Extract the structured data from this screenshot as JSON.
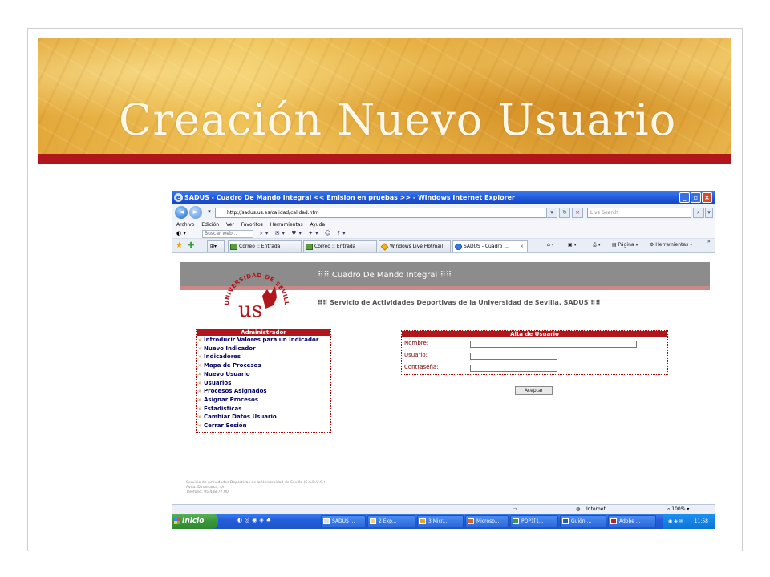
{
  "slide": {
    "title": "Creación Nuevo Usuario"
  },
  "browser": {
    "window_title": "SADUS - Cuadro De Mando Integral << Emision en pruebas >> - Windows Internet Explorer",
    "address": "http://sadus.us.es/calidad/calidad.htm",
    "search_placeholder": "Live Search",
    "search_web_placeholder": "Buscar web...",
    "menu": [
      "Archivo",
      "Edición",
      "Ver",
      "Favoritos",
      "Herramientas",
      "Ayuda"
    ],
    "tabs": [
      {
        "label": "Correo :: Entrada",
        "active": false
      },
      {
        "label": "Correo :: Entrada",
        "active": false
      },
      {
        "label": "Windows Live Hotmail",
        "active": false
      },
      {
        "label": "SADUS - Cuadro ...",
        "active": true
      }
    ],
    "commands": {
      "page": "Página",
      "tools": "Herramientas"
    },
    "status": {
      "zone": "Internet",
      "zoom": "100%"
    }
  },
  "site": {
    "title": "Cuadro De Mando Integral",
    "subtitle": "Servicio de Actividades Deportivas de la Universidad de Sevilla. SADUS",
    "logo_ring_text": "UNIVERSIDAD DE SEVILLA",
    "logo_letters": "us",
    "title_marks": "⠿⠿",
    "footer": [
      "Servicio de Actividades Deportivas de la Universidad de Sevilla (S.A.D.U.S.)",
      "Avda. Dinamarca, s/n",
      "Teléfono: 95.448.77.00"
    ]
  },
  "admin_menu": {
    "title": "Administrador",
    "items": [
      "Introducir Valores para un Indicador",
      "Nuevo Indicador",
      "Indicadores",
      "Mapa de Procesos",
      "Nuevo Usuario",
      "Usuarios",
      "Procesos Asignados",
      "Asignar Procesos",
      "Estadisticas",
      "Cambiar Datos Usuario",
      "Cerrar Sesión"
    ]
  },
  "form": {
    "title": "Alta de Usuario",
    "fields": [
      {
        "label": "Nombre:",
        "value": ""
      },
      {
        "label": "Usuario:",
        "value": ""
      },
      {
        "label": "Contraseña:",
        "value": ""
      }
    ],
    "submit_label": "Aceptar"
  },
  "taskbar": {
    "start_label": "Inicio",
    "tasks": [
      "SADUS ...",
      "2 Exp...",
      "3 Micr...",
      "Microso...",
      "POP1[1...",
      "Guión ...",
      "Adobe ..."
    ],
    "clock": "11:58"
  }
}
